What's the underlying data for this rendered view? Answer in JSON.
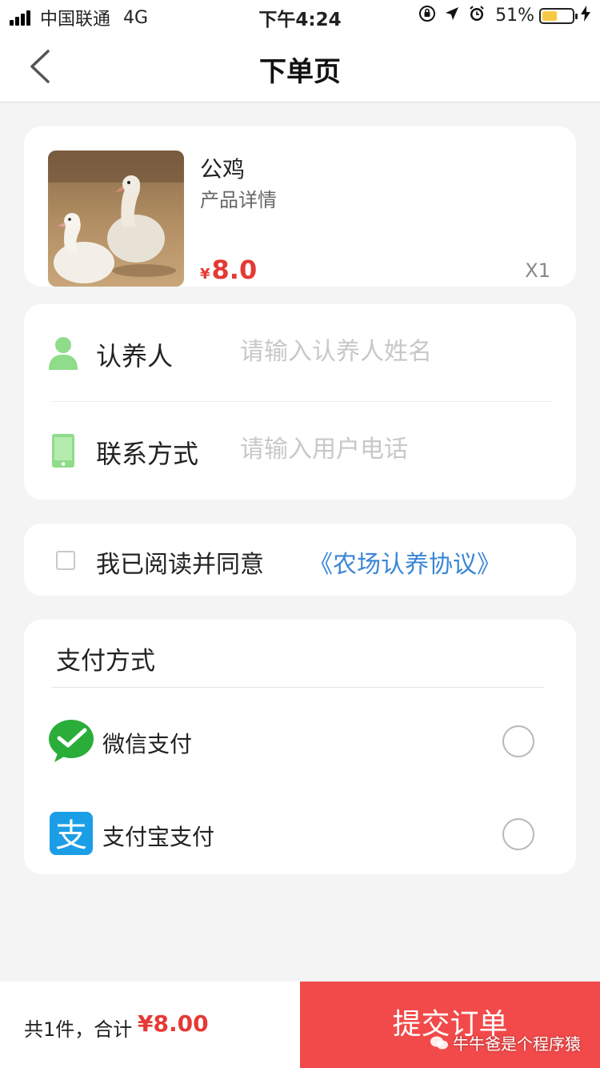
{
  "status_bar": {
    "carrier": "中国联通",
    "network": "4G",
    "time": "下午4:24",
    "battery_percent": "51%",
    "battery_level": 0.51,
    "icons": [
      "signal-icon",
      "rotation-lock-icon",
      "location-icon",
      "alarm-icon",
      "battery-icon",
      "charging-icon"
    ]
  },
  "nav": {
    "title": "下单页",
    "back_icon": "chevron-left-icon"
  },
  "product": {
    "name": "公鸡",
    "detail": "产品详情",
    "currency": "¥",
    "price": "8.0",
    "quantity": "X1"
  },
  "form": {
    "adopter_label": "认养人",
    "adopter_placeholder": "请输入认养人姓名",
    "phone_label": "联系方式",
    "phone_placeholder": "请输入用户电话"
  },
  "agreement": {
    "text": "我已阅读并同意",
    "link": "《农场认养协议》",
    "checked": false
  },
  "payment": {
    "title": "支付方式",
    "options": [
      {
        "label": "微信支付",
        "icon": "wechat-pay-icon",
        "selected": false
      },
      {
        "label": "支付宝支付",
        "icon": "alipay-icon",
        "selected": false
      }
    ]
  },
  "footer": {
    "total_label": "共1件，合计",
    "total_value": "¥8.00",
    "submit_label": "提交订单",
    "watermark": "牛牛爸是个程序猿"
  },
  "colors": {
    "price_red": "#e53935",
    "submit_red": "#f24a4a",
    "link_blue": "#3a86d6",
    "icon_green": "#8fdc8a",
    "wechat_green": "#2aae39",
    "alipay_blue": "#1c9ee6"
  }
}
